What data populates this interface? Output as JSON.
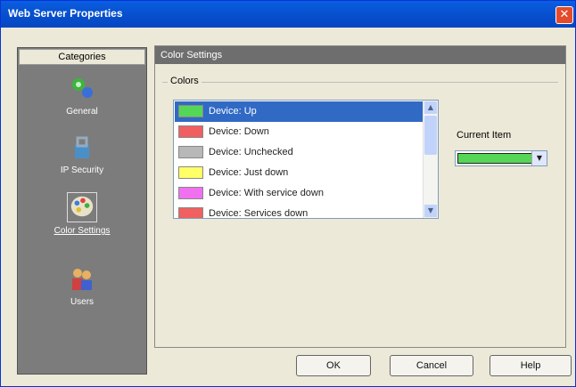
{
  "window": {
    "title": "Web Server Properties"
  },
  "sidebar": {
    "header": "Categories",
    "items": [
      {
        "label": "General",
        "icon": "network-nodes-icon",
        "selected": false
      },
      {
        "label": "IP Security",
        "icon": "security-icon",
        "selected": false
      },
      {
        "label": "Color Settings",
        "icon": "palette-icon",
        "selected": true
      },
      {
        "label": "Users",
        "icon": "users-icon",
        "selected": false
      }
    ]
  },
  "panel": {
    "header": "Color Settings",
    "group_label": "Colors",
    "color_list": [
      {
        "label": "Device: Up",
        "color": "#56d656",
        "selected": true
      },
      {
        "label": "Device: Down",
        "color": "#f06060",
        "selected": false
      },
      {
        "label": "Device: Unchecked",
        "color": "#b8b8b8",
        "selected": false
      },
      {
        "label": "Device: Just down",
        "color": "#ffff66",
        "selected": false
      },
      {
        "label": "Device: With service down",
        "color": "#f070f0",
        "selected": false
      },
      {
        "label": "Device: Services down",
        "color": "#f06060",
        "selected": false
      }
    ],
    "current_item_label": "Current Item",
    "current_item_color": "#56d656"
  },
  "buttons": {
    "ok": "OK",
    "cancel": "Cancel",
    "help": "Help"
  }
}
